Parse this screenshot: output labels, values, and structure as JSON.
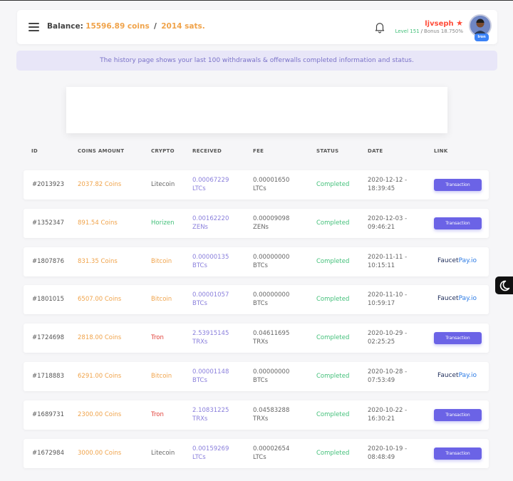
{
  "header": {
    "balance_label": "Balance:",
    "coins": "15596.89 coins",
    "separator": "/",
    "sats": "2014 sats.",
    "username": "ljvseph",
    "level": "Level 151",
    "bonus": "Bonus 18.750%",
    "avatar_badge": "Iron"
  },
  "notice": "The history page shows your last 100 withdrawals & offerwalls completed information and status.",
  "table": {
    "headers": [
      "ID",
      "COINS AMOUNT",
      "CRYPTO",
      "RECEIVED",
      "FEE",
      "STATUS",
      "DATE",
      "LINK"
    ],
    "rows": [
      {
        "id": "#2013923",
        "amount": "2037.82 Coins",
        "crypto": "Litecoin",
        "crypto_color": "#666666",
        "received": "0.00067229",
        "received_unit": "LTCs",
        "fee": "0.00001650",
        "fee_unit": "LTCs",
        "status": "Completed",
        "date": "2020-12-12 -",
        "time": "18:39:45",
        "link_type": "button",
        "link_label": "Transaction"
      },
      {
        "id": "#1352347",
        "amount": "891.54 Coins",
        "crypto": "Horizen",
        "crypto_color": "#43c07a",
        "received": "0.00162220",
        "received_unit": "ZENs",
        "fee": "0.00009098",
        "fee_unit": "ZENs",
        "status": "Completed",
        "date": "2020-12-03 -",
        "time": "09:46:21",
        "link_type": "button",
        "link_label": "Transaction"
      },
      {
        "id": "#1807876",
        "amount": "831.35 Coins",
        "crypto": "Bitcoin",
        "crypto_color": "#f0a34a",
        "received": "0.00000135",
        "received_unit": "BTCs",
        "fee": "0.00000000",
        "fee_unit": "BTCs",
        "status": "Completed",
        "date": "2020-11-11 -",
        "time": "10:15:11",
        "link_type": "faucetpay",
        "link_label": "Faucet",
        "link_label2": "Pay.io"
      },
      {
        "id": "#1801015",
        "amount": "6507.00 Coins",
        "crypto": "Bitcoin",
        "crypto_color": "#f0a34a",
        "received": "0.00001057",
        "received_unit": "BTCs",
        "fee": "0.00000000",
        "fee_unit": "BTCs",
        "status": "Completed",
        "date": "2020-11-10 -",
        "time": "10:59:17",
        "link_type": "faucetpay",
        "link_label": "Faucet",
        "link_label2": "Pay.io"
      },
      {
        "id": "#1724698",
        "amount": "2818.00 Coins",
        "crypto": "Tron",
        "crypto_color": "#e0413a",
        "received": "2.53915145",
        "received_unit": "TRXs",
        "fee": "0.04611695",
        "fee_unit": "TRXs",
        "status": "Completed",
        "date": "2020-10-29 -",
        "time": "02:25:25",
        "link_type": "button",
        "link_label": "Transaction"
      },
      {
        "id": "#1718883",
        "amount": "6291.00 Coins",
        "crypto": "Bitcoin",
        "crypto_color": "#f0a34a",
        "received": "0.00001148",
        "received_unit": "BTCs",
        "fee": "0.00000000",
        "fee_unit": "BTCs",
        "status": "Completed",
        "date": "2020-10-28 -",
        "time": "07:53:49",
        "link_type": "faucetpay",
        "link_label": "Faucet",
        "link_label2": "Pay.io"
      },
      {
        "id": "#1689731",
        "amount": "2300.00 Coins",
        "crypto": "Tron",
        "crypto_color": "#e0413a",
        "received": "2.10831225",
        "received_unit": "TRXs",
        "fee": "0.04583288",
        "fee_unit": "TRXs",
        "status": "Completed",
        "date": "2020-10-22 -",
        "time": "16:30:21",
        "link_type": "button",
        "link_label": "Transaction"
      },
      {
        "id": "#1672984",
        "amount": "3000.00 Coins",
        "crypto": "Litecoin",
        "crypto_color": "#666666",
        "received": "0.00159269",
        "received_unit": "LTCs",
        "fee": "0.00002654",
        "fee_unit": "LTCs",
        "status": "Completed",
        "date": "2020-10-19 -",
        "time": "08:48:49",
        "link_type": "button",
        "link_label": "Transaction"
      }
    ]
  },
  "icons": {
    "menu": "hamburger-menu-icon",
    "notifications": "bell-icon",
    "theme": "moon-icon"
  },
  "colors": {
    "accent": "#6b63e6",
    "coins": "#f0a34a",
    "success": "#43c07a",
    "notice_bg": "#e8e6f8"
  }
}
